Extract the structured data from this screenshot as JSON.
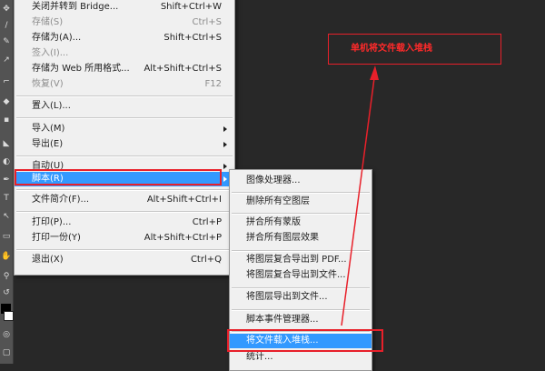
{
  "file_menu": {
    "items": [
      {
        "label": "关闭并转到 Bridge...",
        "shortcut": "Shift+Ctrl+W",
        "enabled": true
      },
      {
        "label": "存储(S)",
        "shortcut": "Ctrl+S",
        "enabled": false
      },
      {
        "label": "存储为(A)...",
        "shortcut": "Shift+Ctrl+S",
        "enabled": true
      },
      {
        "label": "签入(I)...",
        "shortcut": "",
        "enabled": false
      },
      {
        "label": "存储为 Web 所用格式...",
        "shortcut": "Alt+Shift+Ctrl+S",
        "enabled": true
      },
      {
        "label": "恢复(V)",
        "shortcut": "F12",
        "enabled": false
      },
      {
        "label": "置入(L)...",
        "shortcut": "",
        "enabled": true
      },
      {
        "label": "导入(M)",
        "shortcut": "",
        "enabled": true
      },
      {
        "label": "导出(E)",
        "shortcut": "",
        "enabled": true
      },
      {
        "label": "自动(U)",
        "shortcut": "",
        "enabled": true
      },
      {
        "label": "脚本(R)",
        "shortcut": "",
        "enabled": true
      },
      {
        "label": "文件简介(F)...",
        "shortcut": "Alt+Shift+Ctrl+I",
        "enabled": true
      },
      {
        "label": "打印(P)...",
        "shortcut": "Ctrl+P",
        "enabled": true
      },
      {
        "label": "打印一份(Y)",
        "shortcut": "Alt+Shift+Ctrl+P",
        "enabled": true
      },
      {
        "label": "退出(X)",
        "shortcut": "Ctrl+Q",
        "enabled": true
      }
    ]
  },
  "script_menu": {
    "items": [
      {
        "label": "图像处理器...",
        "enabled": true
      },
      {
        "label": "删除所有空图层",
        "enabled": true
      },
      {
        "label": "拼合所有蒙版",
        "enabled": true
      },
      {
        "label": "拼合所有图层效果",
        "enabled": true
      },
      {
        "label": "将图层复合导出到 PDF...",
        "enabled": true
      },
      {
        "label": "将图层复合导出到文件...",
        "enabled": true
      },
      {
        "label": "将图层导出到文件...",
        "enabled": true
      },
      {
        "label": "脚本事件管理器...",
        "enabled": true
      },
      {
        "label": "将文件载入堆栈...",
        "enabled": true
      },
      {
        "label": "统计...",
        "enabled": true
      }
    ]
  },
  "annotation": {
    "text": "单机将文件载入堆栈",
    "color": "#e8202a"
  },
  "toolbar": {
    "icons": [
      "move-icon",
      "brush-icon",
      "pen-icon",
      "type-icon",
      "zoom-icon",
      "eyedropper-icon"
    ]
  },
  "colors": {
    "highlight": "#3399ff",
    "menu_bg": "#f0f0f0",
    "canvas_bg": "#282828",
    "annotation": "#e8202a"
  }
}
